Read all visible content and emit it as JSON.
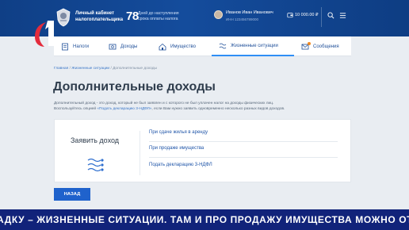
{
  "header": {
    "cabinet_title": "Личный кабинет налогоплательщика",
    "days_count": "78",
    "days_label": "Дней до наступления срока оплаты налога",
    "user_name": "Иванов Иван Иванович",
    "user_inn": "ИНН 123456789000",
    "wallet_amount": "10 000.00 ₽",
    "emblem_icon": "tax-service-emblem-icon",
    "search_icon": "search-icon",
    "menu_icon": "menu-icon"
  },
  "nav": {
    "items": [
      {
        "label": "Налоги",
        "icon": "taxes-icon"
      },
      {
        "label": "Доходы",
        "icon": "income-icon"
      },
      {
        "label": "Имущество",
        "icon": "property-icon"
      },
      {
        "label": "Жизненные ситуации",
        "icon": "life-situations-icon"
      },
      {
        "label": "Сообщения",
        "icon": "messages-icon"
      }
    ],
    "active_index": 3
  },
  "breadcrumb": {
    "home": "Главная",
    "section": "Жизненные ситуации",
    "current": "Дополнительные доходы"
  },
  "page": {
    "title": "Дополнительные доходы",
    "description_part1": "Дополнительный доход - это доход, который не был заявлен и с которого не был уплачен налог на доходы физических лиц.",
    "description_part2": "Воспользуйтесь опцией ",
    "description_link": "«Подать декларацию 3-НДФЛ»",
    "description_part3": ", если Вам нужно заявить одновременно несколько разных видов доходов."
  },
  "card": {
    "title": "Заявить доход",
    "icon": "income-flow-icon",
    "links": [
      "При сдаче жилья в аренду",
      "При продаже имущества",
      "Подать декларацию 3-НДФЛ"
    ]
  },
  "back_button": "НАЗАД",
  "ticker": "АДКУ – ЖИЗНЕННЫЕ СИТУАЦИИ. ТАМ И ПРО ПРОДАЖУ ИМУЩЕСТВА МОЖНО ОТЧ",
  "colors": {
    "header": "#144c9c",
    "accent": "#2f8ef5",
    "button": "#1f62cc",
    "ticker": "#11237a",
    "badge": "#f08a24"
  }
}
